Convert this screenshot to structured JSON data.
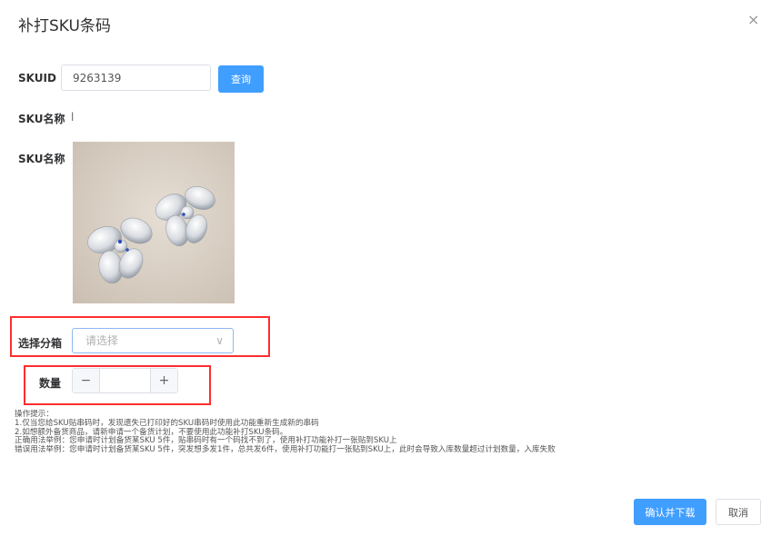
{
  "dialog": {
    "title": "补打SKU条码",
    "close_icon": "×"
  },
  "skuid": {
    "label": "SKUID",
    "value": "9263139",
    "query_label": "查询"
  },
  "sku_name": {
    "label": "SKU名称",
    "value": "l"
  },
  "sku_image": {
    "label": "SKU名称"
  },
  "box_select": {
    "label": "选择分箱",
    "placeholder": "请选择",
    "chevron": "∨"
  },
  "quantity": {
    "label": "数量",
    "minus": "−",
    "plus": "+",
    "value": ""
  },
  "tips": [
    "操作提示：",
    "1.仅当您给SKU贴串码时，发现遗失已打印好的SKU串码时使用此功能重新生成新的串码",
    "2.如想额外备货商品，请新申请一个备货计划，不要使用此功能补打SKU条码。",
    "正确用法举例：您申请时计划备货某SKU 5件，贴串码时有一个码找不到了，使用补打功能补打一张贴到SKU上",
    "错误用法举例：您申请时计划备货某SKU 5件，突发想多发1件，总共发6件，使用补打功能打一张贴到SKU上，此时会导致入库数量超过计划数量，入库失败"
  ],
  "footer": {
    "confirm_label": "确认并下载",
    "cancel_label": "取消"
  },
  "colors": {
    "primary": "#409eff",
    "highlight_border": "#ff2d2d"
  }
}
